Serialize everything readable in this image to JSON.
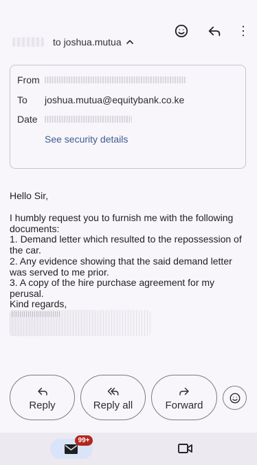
{
  "header": {
    "recipient_summary": "to joshua.mutua",
    "icons": [
      "emoji-icon",
      "reply-icon",
      "more-vertical-icon"
    ]
  },
  "details": {
    "from_label": "From",
    "to_label": "To",
    "to_value": "joshua.mutua@equitybank.co.ke",
    "date_label": "Date",
    "security_link": "See security details"
  },
  "message": {
    "greeting": "Hello Sir,",
    "intro": "I humbly request you to furnish me with the following documents:",
    "item1": "1. Demand letter which resulted to the repossession of the car.",
    "item2": "2. Any evidence showing that the said demand letter was served to me prior.",
    "item3": "3. A copy of the hire purchase agreement for my perusal.",
    "closing": "Kind regards,"
  },
  "actions": {
    "reply": "Reply",
    "reply_all": "Reply all",
    "forward": "Forward"
  },
  "bottom_nav": {
    "mail_badge": "99+"
  },
  "colors": {
    "background": "#f8f6fb",
    "link": "#3e5b91",
    "badge": "#b3261e",
    "active_nav": "#d9e4f8"
  }
}
